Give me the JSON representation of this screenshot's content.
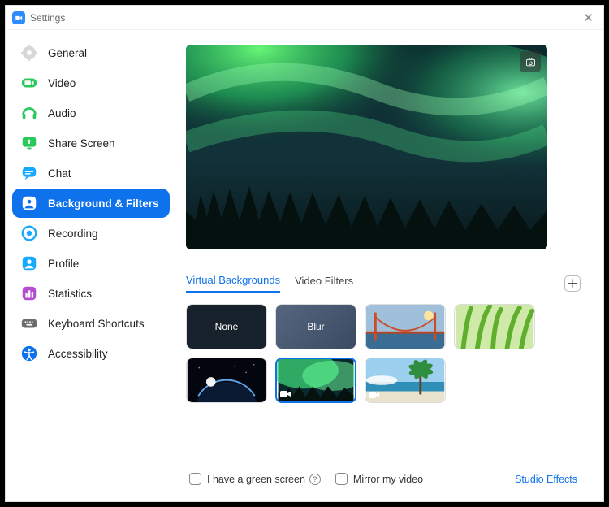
{
  "window": {
    "title": "Settings"
  },
  "sidebar": {
    "items": [
      {
        "label": "General",
        "icon": "gear-icon",
        "color": "#c4c4c4"
      },
      {
        "label": "Video",
        "icon": "video-icon",
        "color": "#28c65a"
      },
      {
        "label": "Audio",
        "icon": "audio-icon",
        "color": "#28c65a"
      },
      {
        "label": "Share Screen",
        "icon": "share-screen-icon",
        "color": "#28c65a"
      },
      {
        "label": "Chat",
        "icon": "chat-icon",
        "color": "#11a6ff"
      },
      {
        "label": "Background & Filters",
        "icon": "background-icon",
        "color": "#ffffff",
        "active": true
      },
      {
        "label": "Recording",
        "icon": "recording-icon",
        "color": "#11a6ff"
      },
      {
        "label": "Profile",
        "icon": "profile-icon",
        "color": "#11a6ff"
      },
      {
        "label": "Statistics",
        "icon": "statistics-icon",
        "color": "#b54dd0"
      },
      {
        "label": "Keyboard Shortcuts",
        "icon": "keyboard-icon",
        "color": "#6b6b6b"
      },
      {
        "label": "Accessibility",
        "icon": "accessibility-icon",
        "color": "#0e72ec"
      }
    ]
  },
  "main": {
    "tabs": {
      "virtual_backgrounds": "Virtual Backgrounds",
      "video_filters": "Video Filters",
      "active": "virtual_backgrounds"
    },
    "thumbnails": {
      "none_label": "None",
      "blur_label": "Blur",
      "stock": [
        {
          "name": "golden-gate-bridge"
        },
        {
          "name": "grass"
        },
        {
          "name": "earth-space"
        },
        {
          "name": "aurora",
          "selected": true
        },
        {
          "name": "beach"
        }
      ]
    },
    "footer": {
      "green_screen_label": "I have a green screen",
      "mirror_label": "Mirror my video",
      "studio_effects_label": "Studio Effects"
    }
  }
}
